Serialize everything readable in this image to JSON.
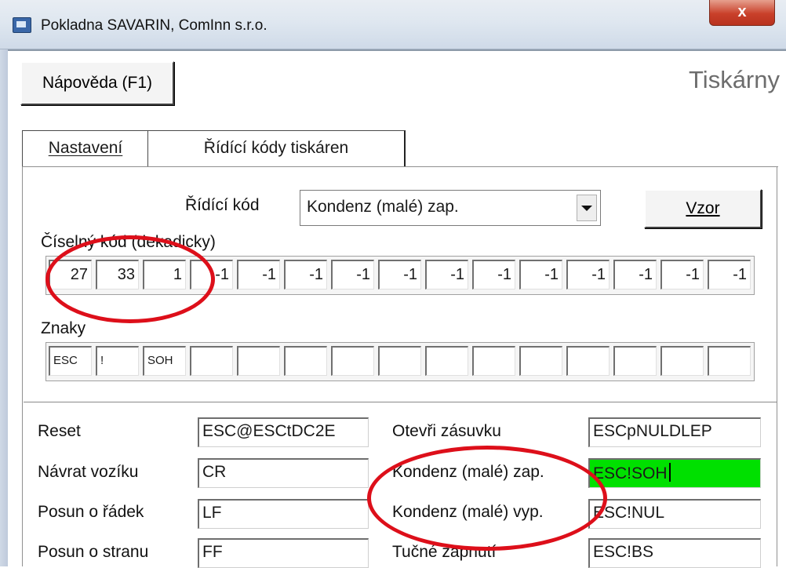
{
  "window": {
    "title": "Pokladna SAVARIN, ComInn s.r.o.",
    "close_label": "x",
    "icon": "app-icon"
  },
  "toolbar": {
    "help_label": "Nápověda (F1)",
    "page_title": "Tiskárny"
  },
  "tabs": [
    {
      "label": "Nastavení",
      "active": false
    },
    {
      "label": "Řídící kódy tiskáren",
      "active": true
    }
  ],
  "control_code": {
    "label": "Řídící kód",
    "selected": "Kondenz (malé) zap.",
    "sample_button": "Vzor"
  },
  "numeric_code": {
    "label": "Číselný kód (dekadicky)",
    "values": [
      "27",
      "33",
      "1",
      "-1",
      "-1",
      "-1",
      "-1",
      "-1",
      "-1",
      "-1",
      "-1",
      "-1",
      "-1",
      "-1",
      "-1"
    ]
  },
  "characters": {
    "label": "Znaky",
    "values": [
      "ESC",
      "!",
      "SOH",
      "",
      "",
      "",
      "",
      "",
      "",
      "",
      "",
      "",
      "",
      "",
      ""
    ]
  },
  "codes": {
    "left": [
      {
        "label": "Reset",
        "value": "ESC@ESCtDC2E"
      },
      {
        "label": "Návrat vozíku",
        "value": "CR"
      },
      {
        "label": "Posun o řádek",
        "value": "LF"
      },
      {
        "label": "Posun o stranu",
        "value": "FF"
      }
    ],
    "right": [
      {
        "label": "Otevři zásuvku",
        "value": "ESCpNULDLEP"
      },
      {
        "label": "Kondenz (malé) zap.",
        "value": "ESC!SOH"
      },
      {
        "label": "Kondenz (malé) vyp.",
        "value": "ESC!NUL"
      },
      {
        "label": "Tučné zapnutí",
        "value": "ESC!BS"
      }
    ]
  },
  "colors": {
    "highlight_field": "#00e000",
    "annotation_ring": "#dd0f1a"
  }
}
